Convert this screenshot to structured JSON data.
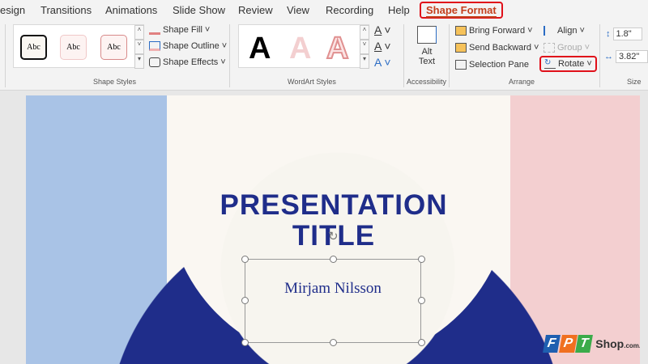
{
  "tabs": [
    "esign",
    "Transitions",
    "Animations",
    "Slide Show",
    "Review",
    "View",
    "Recording",
    "Help",
    "Shape Format"
  ],
  "shape_styles": {
    "samples": [
      "Abc",
      "Abc",
      "Abc"
    ],
    "fill": "Shape Fill",
    "outline": "Shape Outline",
    "effects": "Shape Effects",
    "label": "Shape Styles"
  },
  "wordart": {
    "samples": [
      "A",
      "A",
      "A"
    ],
    "label": "WordArt Styles"
  },
  "accessibility": {
    "alt1": "Alt",
    "alt2": "Text",
    "label": "Accessibility"
  },
  "arrange": {
    "bring_forward": "Bring Forward",
    "send_backward": "Send Backward",
    "selection_pane": "Selection Pane",
    "align": "Align",
    "group": "Group",
    "rotate": "Rotate",
    "label": "Arrange"
  },
  "size": {
    "height": "1.8\"",
    "width": "3.82\"",
    "label": "Size"
  },
  "slide": {
    "title1": "PRESENTATION",
    "title2": "TITLE",
    "subtitle": "Mirjam Nilsson"
  },
  "watermark": {
    "text": "FPT Shop.com.vn"
  },
  "colors": {
    "accent": "#c43e1c",
    "navy": "#1f2d8a",
    "blue": "#a9c3e6",
    "pink": "#f3cfd0"
  }
}
